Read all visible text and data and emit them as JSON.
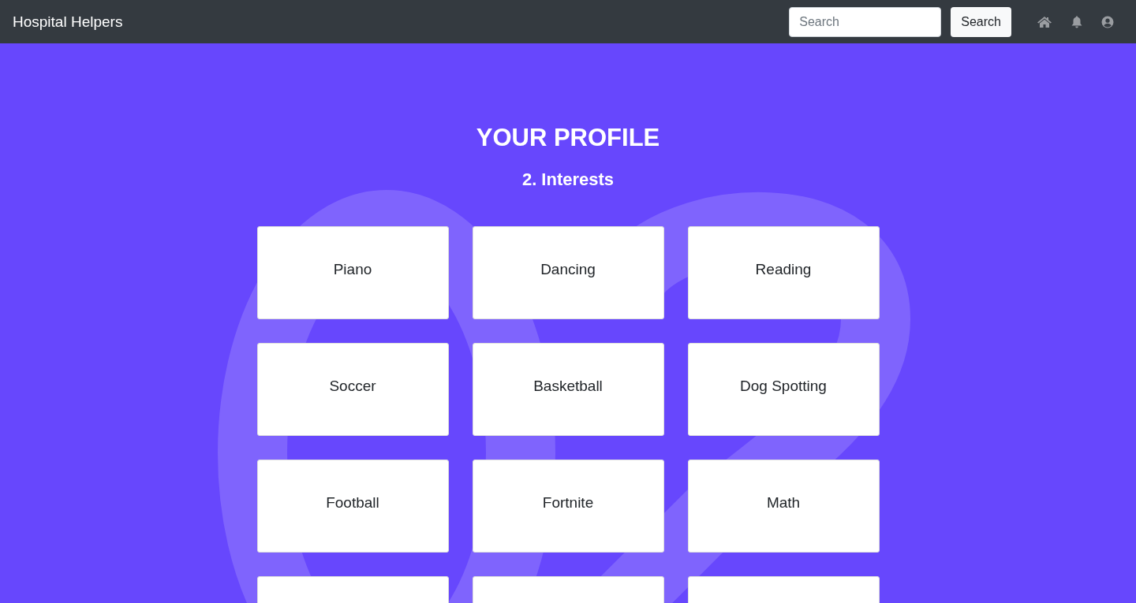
{
  "navbar": {
    "brand": "Hospital Helpers",
    "search": {
      "placeholder": "Search"
    },
    "search_button": "Search"
  },
  "header": {
    "title": "YOUR PROFILE",
    "subtitle": "2. Interests"
  },
  "interests": [
    {
      "kind": "card",
      "label": "Piano"
    },
    {
      "kind": "card",
      "label": "Dancing"
    },
    {
      "kind": "card",
      "label": "Reading"
    },
    {
      "kind": "card",
      "label": "Soccer"
    },
    {
      "kind": "card",
      "label": "Basketball"
    },
    {
      "kind": "card",
      "label": "Dog Spotting"
    },
    {
      "kind": "card",
      "label": "Football"
    },
    {
      "kind": "card",
      "label": "Fortnite"
    },
    {
      "kind": "card",
      "label": "Math"
    },
    {
      "kind": "partial"
    },
    {
      "kind": "partial"
    },
    {
      "kind": "partial"
    }
  ]
}
